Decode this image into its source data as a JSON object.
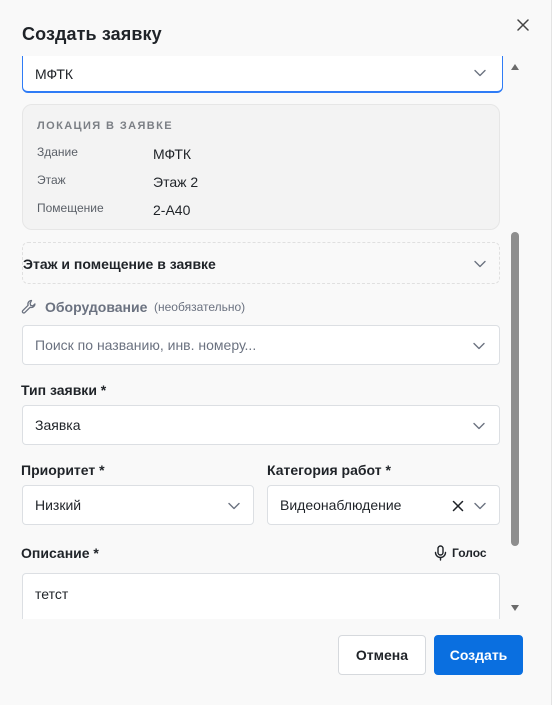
{
  "dialog": {
    "title": "Создать заявку",
    "close_label": "×"
  },
  "location_select": {
    "value": "МФТК"
  },
  "location_card": {
    "title": "ЛОКАЦИЯ В ЗАЯВКЕ",
    "rows": [
      {
        "key": "Здание",
        "value": "МФТК"
      },
      {
        "key": "Этаж",
        "value": "Этаж 2"
      },
      {
        "key": "Помещение",
        "value": "2-А40"
      }
    ]
  },
  "floor_room_section": {
    "label": "Этаж и помещение в заявке"
  },
  "equipment": {
    "label": "Оборудование",
    "optional": "(необязательно)",
    "placeholder": "Поиск по названию, инв. номеру..."
  },
  "request_type": {
    "label": "Тип заявки *",
    "value": "Заявка"
  },
  "priority": {
    "label": "Приоритет *",
    "value": "Низкий"
  },
  "work_category": {
    "label": "Категория работ *",
    "value": "Видеонаблюдение"
  },
  "description": {
    "label": "Описание *",
    "voice_label": "Голос",
    "value": "тетст"
  },
  "footer": {
    "cancel_label": "Отмена",
    "create_label": "Создать"
  },
  "colors": {
    "primary": "#0a6fe0",
    "focus_border": "#2f7cf6",
    "background": "#f9f9f9"
  },
  "icons": [
    "close-icon",
    "chevron-down-icon",
    "wrench-icon",
    "microphone-icon",
    "clear-icon",
    "scroll-up-icon",
    "scroll-down-icon"
  ]
}
